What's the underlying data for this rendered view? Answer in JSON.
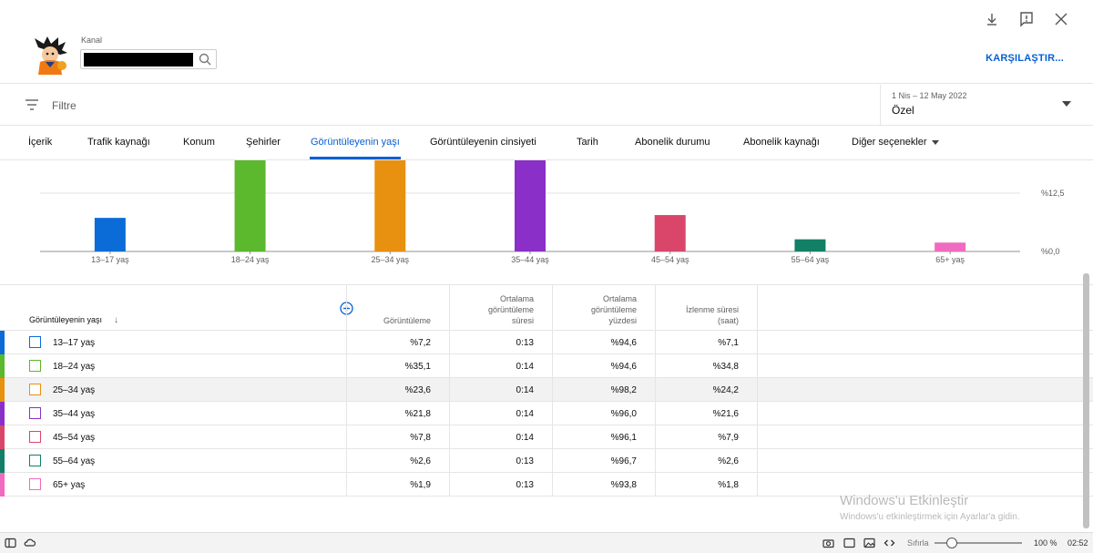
{
  "header": {
    "channel_label": "Kanal",
    "compare_label": "KARŞILAŞTIR...",
    "icons": [
      "download-icon",
      "feedback-icon",
      "close-icon"
    ]
  },
  "filter": {
    "placeholder": "Filtre",
    "date_range": "1 Nis – 12 May 2022",
    "date_type": "Özel"
  },
  "tabs": [
    {
      "label": "İçerik"
    },
    {
      "label": "Trafik kaynağı"
    },
    {
      "label": "Konum"
    },
    {
      "label": "Şehirler"
    },
    {
      "label": "Görüntüleyenin yaşı",
      "active": true
    },
    {
      "label": "Görüntüleyenin cinsiyeti"
    },
    {
      "label": "Tarih"
    },
    {
      "label": "Abonelik durumu"
    },
    {
      "label": "Abonelik kaynağı"
    },
    {
      "label": "Diğer seçenekler"
    }
  ],
  "chart_data": {
    "type": "bar",
    "categories": [
      "13–17 yaş",
      "18–24 yaş",
      "25–34 yaş",
      "35–44 yaş",
      "45–54 yaş",
      "55–64 yaş",
      "65+ yaş"
    ],
    "values": [
      7.2,
      35.1,
      23.6,
      21.8,
      7.8,
      2.6,
      1.9
    ],
    "colors": [
      "#0b6cd8",
      "#5cb82d",
      "#e8900f",
      "#8b2fc9",
      "#d9466a",
      "#128065",
      "#f06ac0"
    ],
    "y_tick_labels": [
      "%0,0",
      "%12,5"
    ],
    "y_ticks": [
      0,
      12.5
    ],
    "ylim": [
      0,
      25
    ],
    "grid": true
  },
  "table": {
    "dimension_header": "Görüntüleyenin yaşı",
    "sort_icon": "arrow-down-icon",
    "columns": [
      "Görüntüleme",
      "Ortalama\ngörüntüleme\nsüresi",
      "Ortalama\ngörüntüleme\nyüzdesi",
      "İzlenme süresi\n(saat)"
    ],
    "rows": [
      {
        "label": "13–17 yaş",
        "color": "#0b6cd8",
        "cells": [
          "%7,2",
          "0:13",
          "%94,6",
          "%7,1"
        ]
      },
      {
        "label": "18–24 yaş",
        "color": "#5cb82d",
        "cells": [
          "%35,1",
          "0:14",
          "%94,6",
          "%34,8"
        ]
      },
      {
        "label": "25–34 yaş",
        "color": "#e8900f",
        "cells": [
          "%23,6",
          "0:14",
          "%98,2",
          "%24,2"
        ]
      },
      {
        "label": "35–44 yaş",
        "color": "#8b2fc9",
        "cells": [
          "%21,8",
          "0:14",
          "%96,0",
          "%21,6"
        ]
      },
      {
        "label": "45–54 yaş",
        "color": "#d9466a",
        "cells": [
          "%7,8",
          "0:14",
          "%96,1",
          "%7,9"
        ]
      },
      {
        "label": "55–64 yaş",
        "color": "#128065",
        "cells": [
          "%2,6",
          "0:13",
          "%96,7",
          "%2,6"
        ]
      },
      {
        "label": "65+ yaş",
        "color": "#f06ac0",
        "cells": [
          "%1,9",
          "0:13",
          "%93,8",
          "%1,8"
        ]
      }
    ]
  },
  "watermark": {
    "title": "Windows'u Etkinleştir",
    "subtitle": "Windows'u etkinleştirmek için Ayarlar'a gidin."
  },
  "statusbar": {
    "reset_label": "Sıfırla",
    "zoom": "100 %",
    "time": "02:52",
    "zoom_level": 0.15
  }
}
